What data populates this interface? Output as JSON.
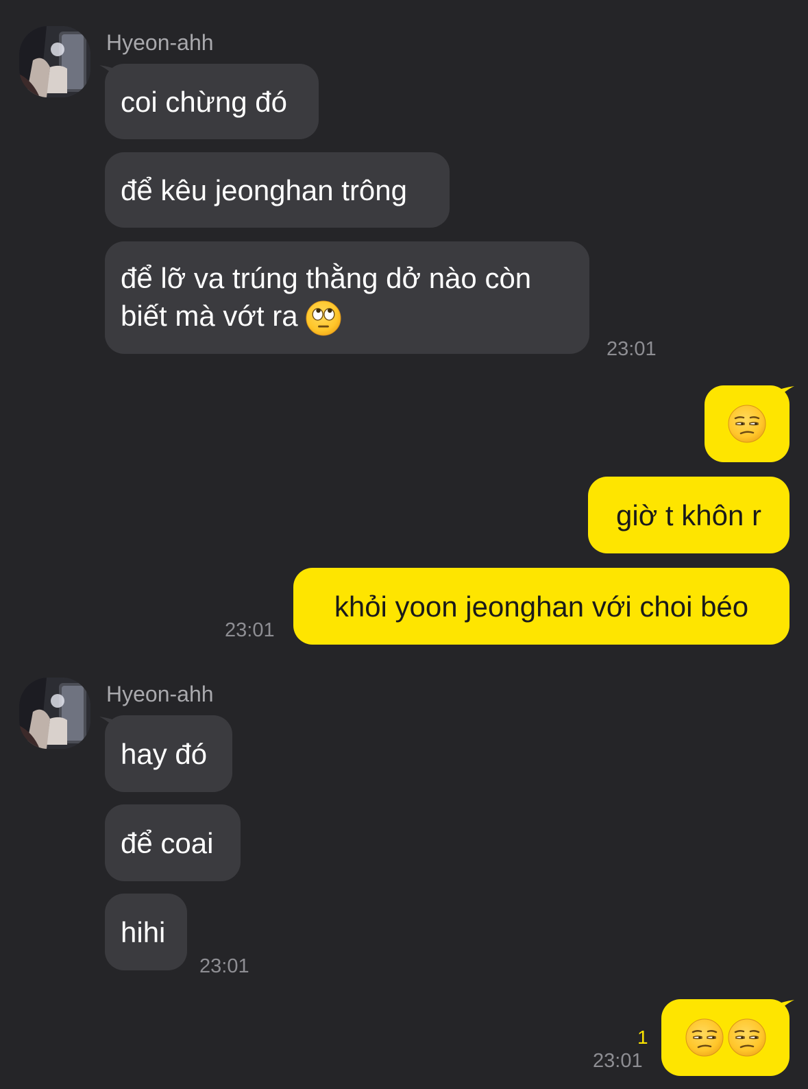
{
  "colors": {
    "background": "#252528",
    "incoming_bubble": "#3b3b3f",
    "outgoing_bubble": "#fee500",
    "timestamp": "#8e8e93",
    "sender_name": "#a9a9ad",
    "unread": "#fee500"
  },
  "groups": [
    {
      "sender": "Hyeon-ahh",
      "messages": [
        {
          "text": "coi chừng đó"
        },
        {
          "text": "để kêu jeonghan trông"
        },
        {
          "text": "để lỡ va trúng thằng dở nào còn biết mà vớt ra",
          "emoji": "face-with-rolling-eyes-icon"
        }
      ],
      "time": "23:01"
    },
    {
      "sender": "me",
      "messages": [
        {
          "emoji": "unamused-face-icon"
        },
        {
          "text": "giờ t khôn r"
        },
        {
          "text": "khỏi yoon jeonghan với choi béo"
        }
      ],
      "time": "23:01"
    },
    {
      "sender": "Hyeon-ahh",
      "messages": [
        {
          "text": "hay đó"
        },
        {
          "text": "để coai"
        },
        {
          "text": "hihi"
        }
      ],
      "time": "23:01"
    },
    {
      "sender": "me",
      "messages": [
        {
          "emoji": "unamused-face-icon x2"
        }
      ],
      "unread_count": "1",
      "time": "23:01"
    }
  ]
}
